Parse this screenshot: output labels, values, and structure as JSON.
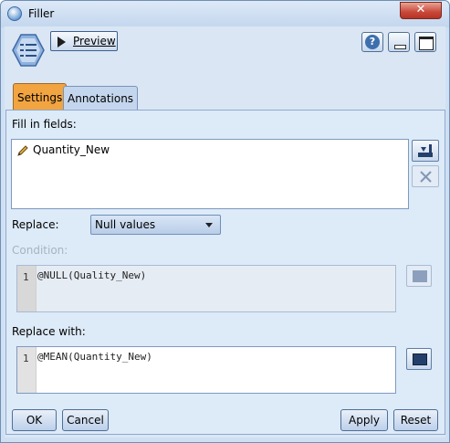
{
  "window": {
    "title": "Filler",
    "close_label": "✕"
  },
  "toolbar": {
    "preview_label": "Preview",
    "help_label": "?"
  },
  "tabs": [
    {
      "label": "Settings"
    },
    {
      "label": "Annotations"
    }
  ],
  "settings": {
    "fill_in_fields_label": "Fill in fields:",
    "fields": [
      "Quantity_New"
    ],
    "replace_label": "Replace:",
    "replace_value": "Null values",
    "condition_label": "Condition:",
    "condition_line": "1",
    "condition_expr": "@NULL(Quality_New)",
    "replace_with_label": "Replace with:",
    "replace_with_line": "1",
    "replace_with_expr": "@MEAN(Quantity_New)"
  },
  "buttons": {
    "ok": "OK",
    "cancel": "Cancel",
    "apply": "Apply",
    "reset": "Reset"
  },
  "colors": {
    "active_tab": "#f2a441",
    "panel": "#ddeaf8",
    "title_bar": "#c3d6ee"
  }
}
